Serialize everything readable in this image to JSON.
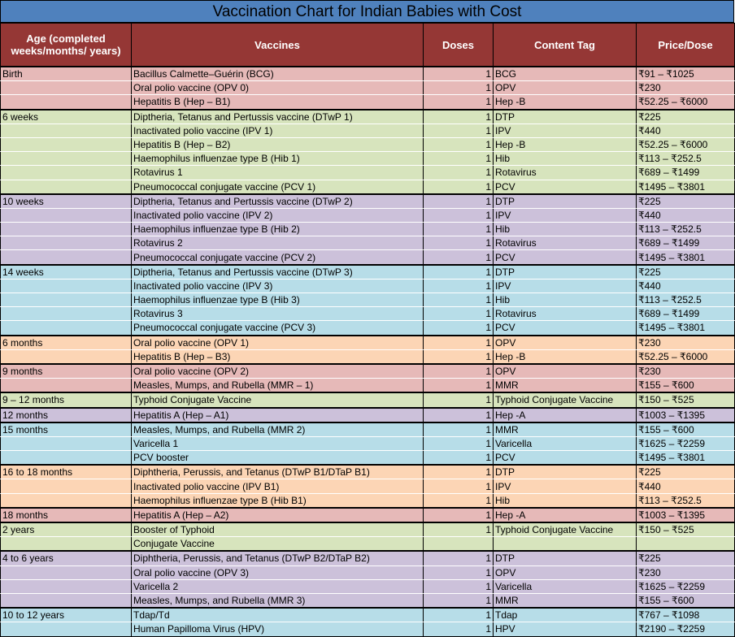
{
  "title": "Vaccination Chart for Indian Babies with Cost",
  "colors": {
    "title_bg": "#4f81bd",
    "header_bg": "#953735",
    "red": "#e6b9b8",
    "green": "#d7e4bd",
    "purple": "#ccc1da",
    "blue": "#b7dde8",
    "orange": "#fcd5b5"
  },
  "headers": [
    "Age (completed weeks/months/ years)",
    "Vaccines",
    "Doses",
    "Content Tag",
    "Price/Dose"
  ],
  "rows": [
    {
      "age": "Birth",
      "vaccine": "Bacillus Calmette–Guérin (BCG)",
      "doses": "1",
      "tag": "BCG",
      "price": "₹91 – ₹1025",
      "color": "red",
      "start": true
    },
    {
      "age": "",
      "vaccine": "Oral polio vaccine (OPV 0)",
      "doses": "1",
      "tag": "OPV",
      "price": "₹230",
      "color": "red"
    },
    {
      "age": "",
      "vaccine": "Hepatitis B (Hep – B1)",
      "doses": "1",
      "tag": "Hep -B",
      "price": "₹52.25 – ₹6000",
      "color": "red"
    },
    {
      "age": "6 weeks",
      "vaccine": "Diptheria, Tetanus and Pertussis vaccine (DTwP 1)",
      "doses": "1",
      "tag": "DTP",
      "price": "₹225",
      "color": "green",
      "start": true
    },
    {
      "age": "",
      "vaccine": "Inactivated polio vaccine (IPV 1)",
      "doses": "1",
      "tag": "IPV",
      "price": "₹440",
      "color": "green"
    },
    {
      "age": "",
      "vaccine": "Hepatitis B  (Hep – B2)",
      "doses": "1",
      "tag": "Hep -B",
      "price": "₹52.25 – ₹6000",
      "color": "green"
    },
    {
      "age": "",
      "vaccine": "Haemophilus influenzae type B (Hib 1)",
      "doses": "1",
      "tag": "Hib",
      "price": "₹113 – ₹252.5",
      "color": "green"
    },
    {
      "age": "",
      "vaccine": "Rotavirus 1",
      "doses": "1",
      "tag": "Rotavirus",
      "price": "₹689 – ₹1499",
      "color": "green"
    },
    {
      "age": "",
      "vaccine": "Pneumococcal conjugate vaccine (PCV 1)",
      "doses": "1",
      "tag": "PCV",
      "price": "₹1495 – ₹3801",
      "color": "green"
    },
    {
      "age": "10 weeks",
      "vaccine": "Diptheria, Tetanus and Pertussis vaccine (DTwP 2)",
      "doses": "1",
      "tag": "DTP",
      "price": "₹225",
      "color": "purple",
      "start": true
    },
    {
      "age": "",
      "vaccine": "Inactivated polio vaccine (IPV 2)",
      "doses": "1",
      "tag": "IPV",
      "price": "₹440",
      "color": "purple"
    },
    {
      "age": "",
      "vaccine": "Haemophilus influenzae type B (Hib 2)",
      "doses": "1",
      "tag": "Hib",
      "price": "₹113 – ₹252.5",
      "color": "purple"
    },
    {
      "age": "",
      "vaccine": "Rotavirus 2",
      "doses": "1",
      "tag": "Rotavirus",
      "price": "₹689 – ₹1499",
      "color": "purple"
    },
    {
      "age": "",
      "vaccine": "Pneumococcal conjugate vaccine (PCV 2)",
      "doses": "1",
      "tag": "PCV",
      "price": "₹1495 – ₹3801",
      "color": "purple"
    },
    {
      "age": "14 weeks",
      "vaccine": "Diptheria, Tetanus and Pertussis vaccine (DTwP 3)",
      "doses": "1",
      "tag": "DTP",
      "price": "₹225",
      "color": "blue",
      "start": true
    },
    {
      "age": "",
      "vaccine": "Inactivated polio vaccine (IPV 3)",
      "doses": "1",
      "tag": "IPV",
      "price": "₹440",
      "color": "blue"
    },
    {
      "age": "",
      "vaccine": "Haemophilus influenzae type B (Hib 3)",
      "doses": "1",
      "tag": "Hib",
      "price": "₹113 – ₹252.5",
      "color": "blue"
    },
    {
      "age": "",
      "vaccine": "Rotavirus 3",
      "doses": "1",
      "tag": "Rotavirus",
      "price": "₹689 – ₹1499",
      "color": "blue"
    },
    {
      "age": "",
      "vaccine": "Pneumococcal conjugate vaccine (PCV 3)",
      "doses": "1",
      "tag": "PCV",
      "price": "₹1495 – ₹3801",
      "color": "blue"
    },
    {
      "age": "6 months",
      "vaccine": "Oral polio vaccine (OPV 1)",
      "doses": "1",
      "tag": "OPV",
      "price": "₹230",
      "color": "orange",
      "start": true
    },
    {
      "age": "",
      "vaccine": "Hepatitis B (Hep – B3)",
      "doses": "1",
      "tag": "Hep -B",
      "price": "₹52.25 – ₹6000",
      "color": "orange"
    },
    {
      "age": "9 months",
      "vaccine": "Oral polio vaccine (OPV 2)",
      "doses": "1",
      "tag": "OPV",
      "price": "₹230",
      "color": "red",
      "start": true
    },
    {
      "age": "",
      "vaccine": "Measles, Mumps, and Rubella (MMR – 1)",
      "doses": "1",
      "tag": "MMR",
      "price": "₹155 – ₹600",
      "color": "red"
    },
    {
      "age": "9 – 12 months",
      "vaccine": "Typhoid Conjugate Vaccine",
      "doses": "1",
      "tag": "Typhoid Conjugate Vaccine",
      "price": "₹150 – ₹525",
      "color": "green",
      "start": true
    },
    {
      "age": "12 months",
      "vaccine": "Hepatitis A (Hep – A1)",
      "doses": "1",
      "tag": "Hep -A",
      "price": "₹1003 – ₹1395",
      "color": "purple",
      "start": true
    },
    {
      "age": "15 months",
      "vaccine": "Measles, Mumps, and Rubella (MMR 2)",
      "doses": "1",
      "tag": "MMR",
      "price": "₹155 – ₹600",
      "color": "blue",
      "start": true
    },
    {
      "age": "",
      "vaccine": "Varicella 1",
      "doses": "1",
      "tag": "Varicella",
      "price": "₹1625 – ₹2259",
      "color": "blue"
    },
    {
      "age": "",
      "vaccine": "PCV booster",
      "doses": "1",
      "tag": "PCV",
      "price": "₹1495 – ₹3801",
      "color": "blue"
    },
    {
      "age": "16 to 18 months",
      "vaccine": "Diphtheria, Perussis, and Tetanus (DTwP B1/DTaP B1)",
      "doses": "1",
      "tag": "DTP",
      "price": "₹225",
      "color": "orange",
      "start": true
    },
    {
      "age": "",
      "vaccine": "Inactivated polio vaccine (IPV B1)",
      "doses": "1",
      "tag": "IPV",
      "price": "₹440",
      "color": "orange"
    },
    {
      "age": "",
      "vaccine": "Haemophilus influenzae type B (Hib B1)",
      "doses": "1",
      "tag": "Hib",
      "price": "₹113 – ₹252.5",
      "color": "orange"
    },
    {
      "age": "18 months",
      "vaccine": "Hepatitis A (Hep – A2)",
      "doses": "1",
      "tag": "Hep -A",
      "price": "₹1003 – ₹1395",
      "color": "red",
      "start": true
    },
    {
      "age": "2 years",
      "vaccine": "Booster of Typhoid",
      "doses": "1",
      "tag": "Typhoid Conjugate Vaccine",
      "price": "₹150 – ₹525",
      "color": "green",
      "start": true
    },
    {
      "age": "",
      "vaccine": "Conjugate Vaccine",
      "doses": "",
      "tag": "",
      "price": "",
      "color": "green"
    },
    {
      "age": "4 to 6 years",
      "vaccine": "Diphtheria, Perussis, and Tetanus (DTwP B2/DTaP B2)",
      "doses": "1",
      "tag": "DTP",
      "price": "₹225",
      "color": "purple",
      "start": true
    },
    {
      "age": "",
      "vaccine": "Oral polio vaccine (OPV 3)",
      "doses": "1",
      "tag": "OPV",
      "price": "₹230",
      "color": "purple"
    },
    {
      "age": "",
      "vaccine": "Varicella 2",
      "doses": "1",
      "tag": "Varicella",
      "price": "₹1625 – ₹2259",
      "color": "purple"
    },
    {
      "age": "",
      "vaccine": "Measles, Mumps, and Rubella (MMR 3)",
      "doses": "1",
      "tag": "MMR",
      "price": "₹155 – ₹600",
      "color": "purple"
    },
    {
      "age": "10 to 12 years",
      "vaccine": "Tdap/Td",
      "doses": "1",
      "tag": "Tdap",
      "price": "₹767 – ₹1098",
      "color": "blue",
      "start": true
    },
    {
      "age": "",
      "vaccine": "Human Papilloma Virus (HPV)",
      "doses": "1",
      "tag": "HPV",
      "price": "₹2190 – ₹2259",
      "color": "blue"
    }
  ]
}
